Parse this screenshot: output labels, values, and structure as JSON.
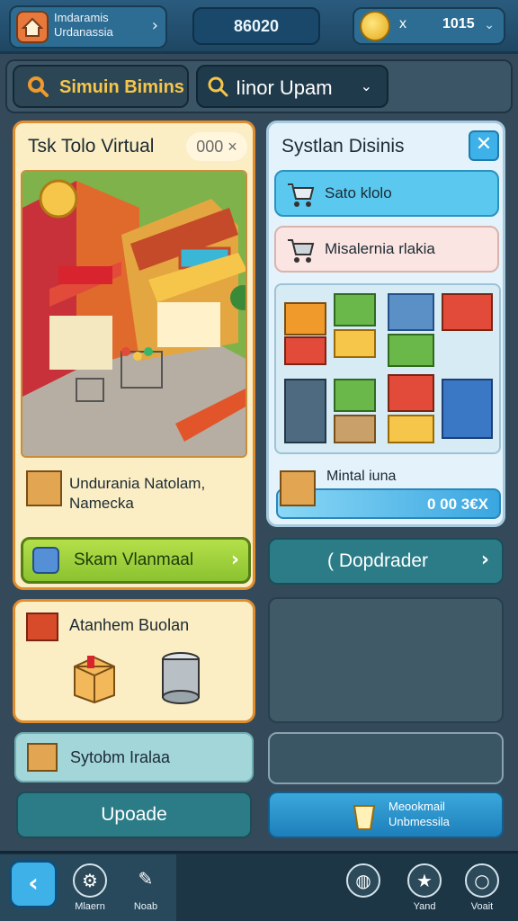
{
  "profile": {
    "line1": "Imdaramis",
    "line2": "Urdanassia"
  },
  "header": {
    "score": "86020",
    "coins_x": "x",
    "coins": "1015"
  },
  "search": {
    "label": "Simuin Bimins",
    "dropdown_label": "Iinor Upam"
  },
  "card_left": {
    "title": "Tsk Tolo Virtual",
    "badge": "000 ×",
    "info_line1": "Undurania Natolam,",
    "info_line2": "Namecka",
    "action_label": "Skam Vlanmaal"
  },
  "card_right": {
    "title": "Systlan Disinis",
    "close": "✕",
    "option1": "Sato klolo",
    "option2": "Misalernia rlakia",
    "item_name": "Mintal iuna",
    "item_value": "0 00 3€X"
  },
  "dopdrade": {
    "label": "( Dopdrader"
  },
  "card_left2": {
    "title": "Atanhem Buolan"
  },
  "sytrow": {
    "label": "Sytobm Iralaa"
  },
  "upgrade": {
    "label": "Upoade"
  },
  "mbutton": {
    "line1": "Meookmail",
    "line2": "Unbmessila"
  },
  "nav": {
    "back": "‹",
    "item1": "Mlaern",
    "item2": "Noab",
    "item4": "Yand",
    "item5": "Voait"
  },
  "colors": {
    "accent_orange": "#e08d2e",
    "accent_blue": "#3db1e8",
    "accent_green": "#8bc230",
    "teal": "#2b7c87"
  },
  "icons": [
    "home-icon",
    "coin-icon",
    "search-icon",
    "close-icon",
    "cart-icon",
    "box-icon",
    "can-icon",
    "cup-icon",
    "gear-icon",
    "broom-icon",
    "globe-icon",
    "star-icon",
    "magnifier-icon",
    "back-icon"
  ]
}
